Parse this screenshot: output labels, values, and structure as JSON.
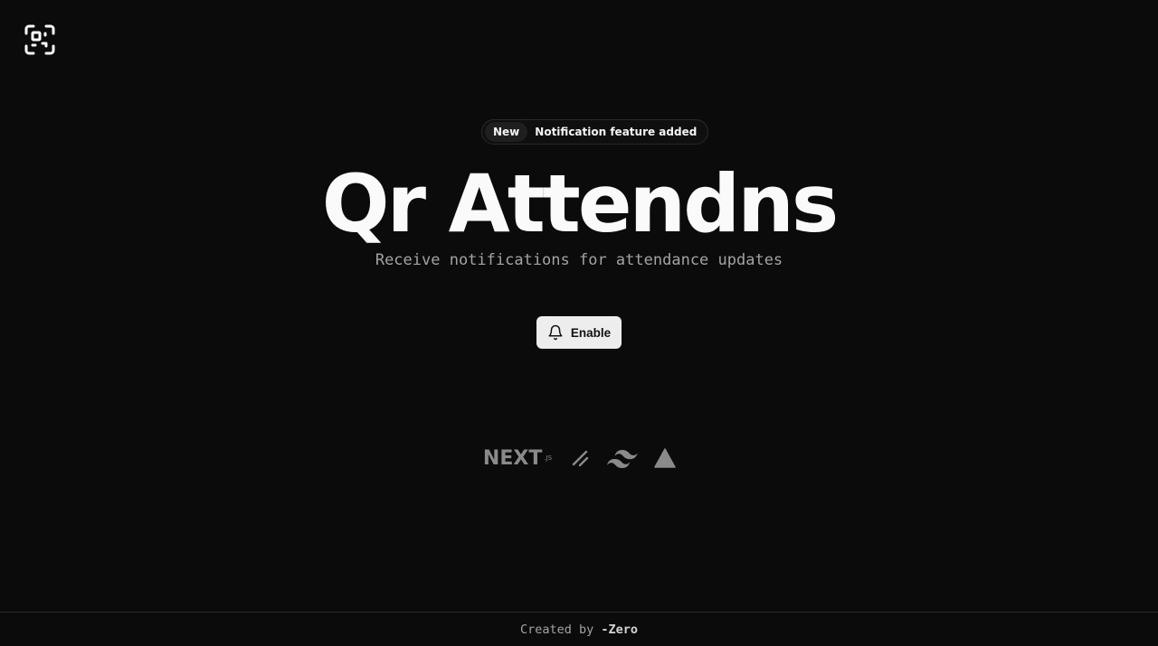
{
  "header": {
    "logo_icon": "scan-qr-icon"
  },
  "announcement": {
    "badge": "New",
    "message": "Notification feature added"
  },
  "hero": {
    "title": "Qr Attendns",
    "subtitle": "Receive notifications for attendance updates"
  },
  "action": {
    "icon": "bell-icon",
    "label": "Enable"
  },
  "tech_stack": [
    {
      "name": "nextjs",
      "label": "NEXT",
      "sublabel": ".JS",
      "icon": "nextjs-icon"
    },
    {
      "name": "shadcn",
      "icon": "shadcn-icon"
    },
    {
      "name": "tailwind",
      "icon": "tailwind-icon"
    },
    {
      "name": "vercel",
      "icon": "vercel-icon"
    }
  ],
  "footer": {
    "prefix": "Created by",
    "author": "-Zero"
  },
  "colors": {
    "background": "#0b0b0b",
    "text": "#fafafa",
    "muted": "#a3a3a3",
    "button_bg": "#ededed",
    "icon_gray": "#8a8a8a"
  }
}
